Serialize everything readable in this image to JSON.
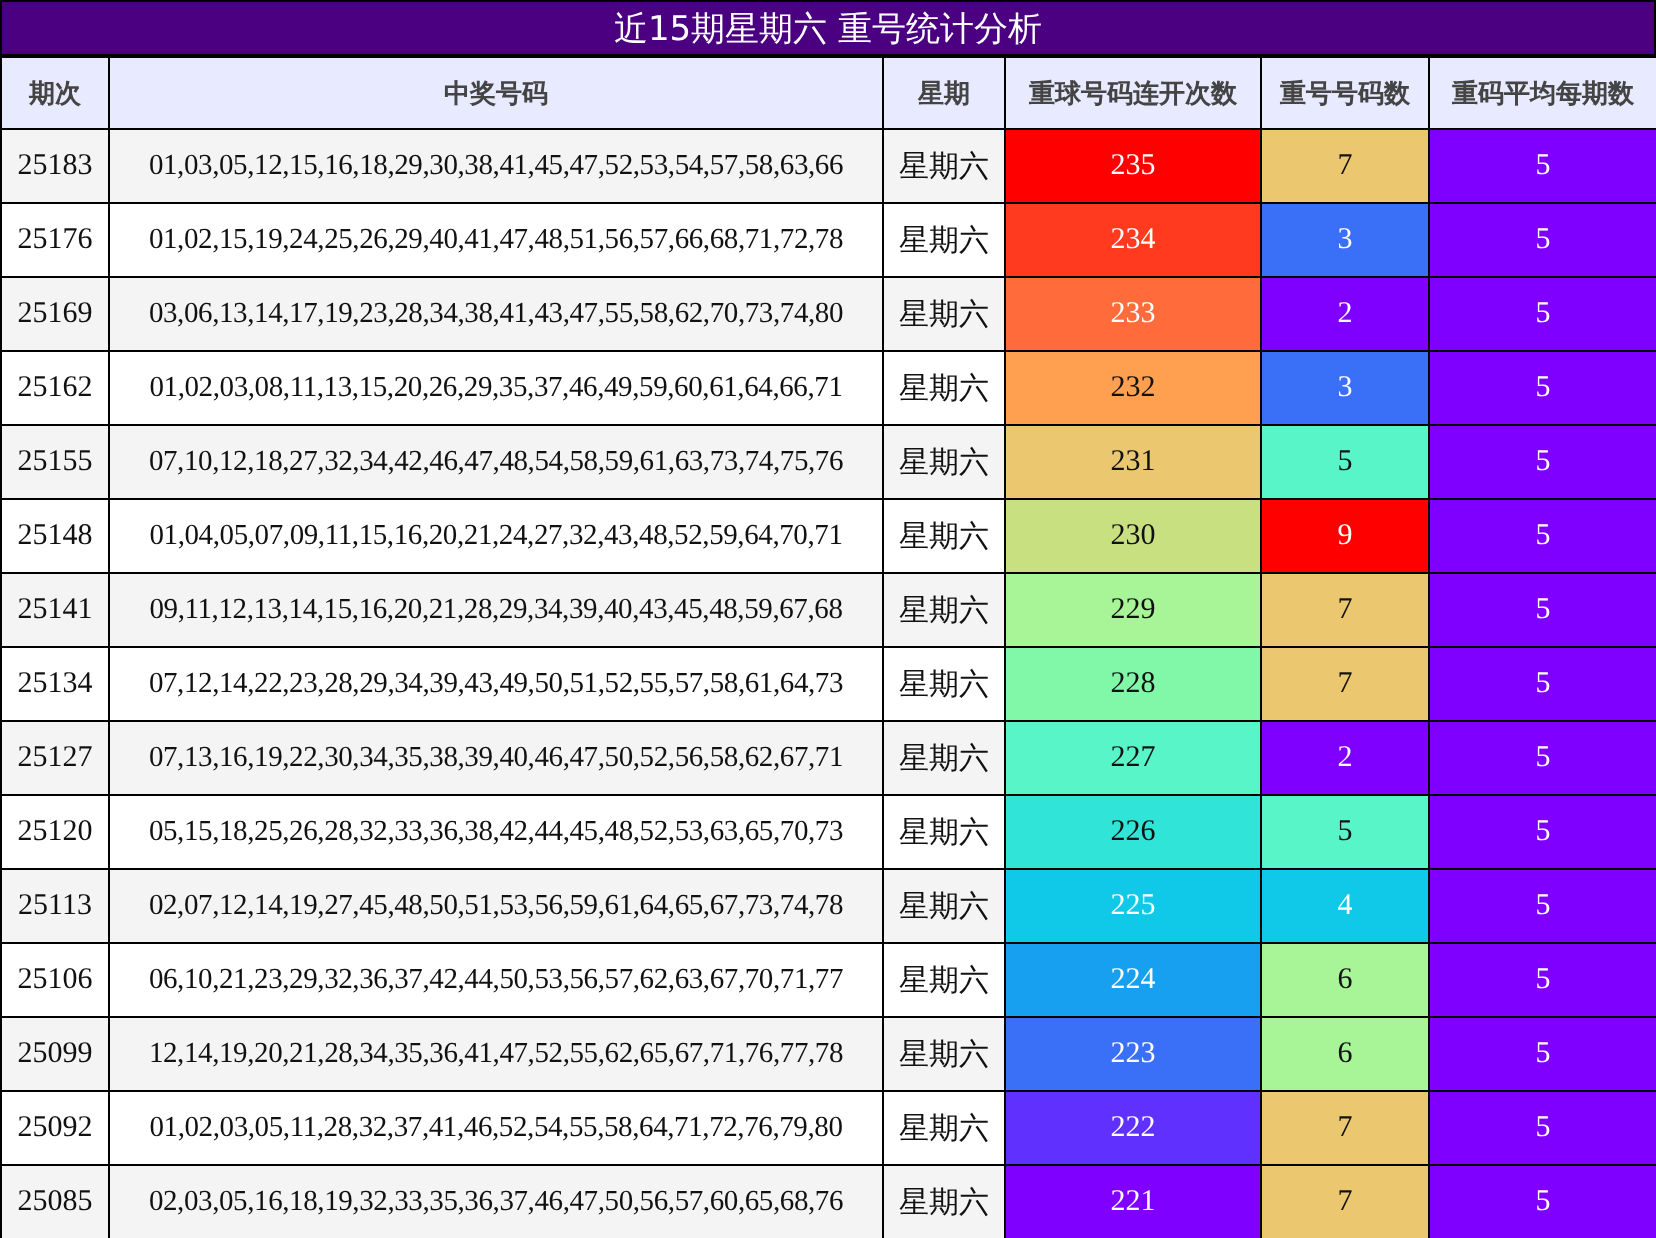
{
  "title": "近15期星期六 重号统计分析",
  "columns": [
    "期次",
    "中奖号码",
    "星期",
    "重球号码连开次数",
    "重号号码数",
    "重码平均每期数"
  ],
  "rows": [
    {
      "issue": "25183",
      "numbers": "01,03,05,12,15,16,18,29,30,38,41,45,47,52,53,54,57,58,63,66",
      "weekday": "星期六",
      "streak": {
        "text": "235",
        "color": "#ff0000"
      },
      "repeats": {
        "text": "7",
        "color": "#ebc870"
      },
      "average": {
        "text": "5",
        "color": "#8000ff"
      }
    },
    {
      "issue": "25176",
      "numbers": "01,02,15,19,24,25,26,29,40,41,47,48,51,56,57,66,68,71,72,78",
      "weekday": "星期六",
      "streak": {
        "text": "234",
        "color": "#ff3a1f"
      },
      "repeats": {
        "text": "3",
        "color": "#3a70f8"
      },
      "average": {
        "text": "5",
        "color": "#8000ff"
      }
    },
    {
      "issue": "25169",
      "numbers": "03,06,13,14,17,19,23,28,34,38,41,43,47,55,58,62,70,73,74,80",
      "weekday": "星期六",
      "streak": {
        "text": "233",
        "color": "#ff6b3a"
      },
      "repeats": {
        "text": "2",
        "color": "#8000ff"
      },
      "average": {
        "text": "5",
        "color": "#8000ff"
      }
    },
    {
      "issue": "25162",
      "numbers": "01,02,03,08,11,13,15,20,26,29,35,37,46,49,59,60,61,64,66,71",
      "weekday": "星期六",
      "streak": {
        "text": "232",
        "color": "#ffa050"
      },
      "repeats": {
        "text": "3",
        "color": "#3a70f8"
      },
      "average": {
        "text": "5",
        "color": "#8000ff"
      }
    },
    {
      "issue": "25155",
      "numbers": "07,10,12,18,27,32,34,42,46,47,48,54,58,59,61,63,73,74,75,76",
      "weekday": "星期六",
      "streak": {
        "text": "231",
        "color": "#ebc870"
      },
      "repeats": {
        "text": "5",
        "color": "#58f5c8"
      },
      "average": {
        "text": "5",
        "color": "#8000ff"
      }
    },
    {
      "issue": "25148",
      "numbers": "01,04,05,07,09,11,15,16,20,21,24,27,32,43,48,52,59,64,70,71",
      "weekday": "星期六",
      "streak": {
        "text": "230",
        "color": "#c8e080"
      },
      "repeats": {
        "text": "9",
        "color": "#ff0000"
      },
      "average": {
        "text": "5",
        "color": "#8000ff"
      }
    },
    {
      "issue": "25141",
      "numbers": "09,11,12,13,14,15,16,20,21,28,29,34,39,40,43,45,48,59,67,68",
      "weekday": "星期六",
      "streak": {
        "text": "229",
        "color": "#a8f598"
      },
      "repeats": {
        "text": "7",
        "color": "#ebc870"
      },
      "average": {
        "text": "5",
        "color": "#8000ff"
      }
    },
    {
      "issue": "25134",
      "numbers": "07,12,14,22,23,28,29,34,39,43,49,50,51,52,55,57,58,61,64,73",
      "weekday": "星期六",
      "streak": {
        "text": "228",
        "color": "#80f8a8"
      },
      "repeats": {
        "text": "7",
        "color": "#ebc870"
      },
      "average": {
        "text": "5",
        "color": "#8000ff"
      }
    },
    {
      "issue": "25127",
      "numbers": "07,13,16,19,22,30,34,35,38,39,40,46,47,50,52,56,58,62,67,71",
      "weekday": "星期六",
      "streak": {
        "text": "227",
        "color": "#58f5c8"
      },
      "repeats": {
        "text": "2",
        "color": "#8000ff"
      },
      "average": {
        "text": "5",
        "color": "#8000ff"
      }
    },
    {
      "issue": "25120",
      "numbers": "05,15,18,25,26,28,32,33,36,38,42,44,45,48,52,53,63,65,70,73",
      "weekday": "星期六",
      "streak": {
        "text": "226",
        "color": "#30e5d8"
      },
      "repeats": {
        "text": "5",
        "color": "#58f5c8"
      },
      "average": {
        "text": "5",
        "color": "#8000ff"
      }
    },
    {
      "issue": "25113",
      "numbers": "02,07,12,14,19,27,45,48,50,51,53,56,59,61,64,65,67,73,74,78",
      "weekday": "星期六",
      "streak": {
        "text": "225",
        "color": "#10c8e8"
      },
      "repeats": {
        "text": "4",
        "color": "#10c8e8"
      },
      "average": {
        "text": "5",
        "color": "#8000ff"
      }
    },
    {
      "issue": "25106",
      "numbers": "06,10,21,23,29,32,36,37,42,44,50,53,56,57,62,63,67,70,71,77",
      "weekday": "星期六",
      "streak": {
        "text": "224",
        "color": "#18a0f0"
      },
      "repeats": {
        "text": "6",
        "color": "#a8f598"
      },
      "average": {
        "text": "5",
        "color": "#8000ff"
      }
    },
    {
      "issue": "25099",
      "numbers": "12,14,19,20,21,28,34,35,36,41,47,52,55,62,65,67,71,76,77,78",
      "weekday": "星期六",
      "streak": {
        "text": "223",
        "color": "#3a70f8"
      },
      "repeats": {
        "text": "6",
        "color": "#a8f598"
      },
      "average": {
        "text": "5",
        "color": "#8000ff"
      }
    },
    {
      "issue": "25092",
      "numbers": "01,02,03,05,11,28,32,37,41,46,52,54,55,58,64,71,72,76,79,80",
      "weekday": "星期六",
      "streak": {
        "text": "222",
        "color": "#6030ff"
      },
      "repeats": {
        "text": "7",
        "color": "#ebc870"
      },
      "average": {
        "text": "5",
        "color": "#8000ff"
      }
    },
    {
      "issue": "25085",
      "numbers": "02,03,05,16,18,19,32,33,35,36,37,46,47,50,56,57,60,65,68,76",
      "weekday": "星期六",
      "streak": {
        "text": "221",
        "color": "#8000ff"
      },
      "repeats": {
        "text": "7",
        "color": "#ebc870"
      },
      "average": {
        "text": "5",
        "color": "#8000ff"
      }
    }
  ]
}
